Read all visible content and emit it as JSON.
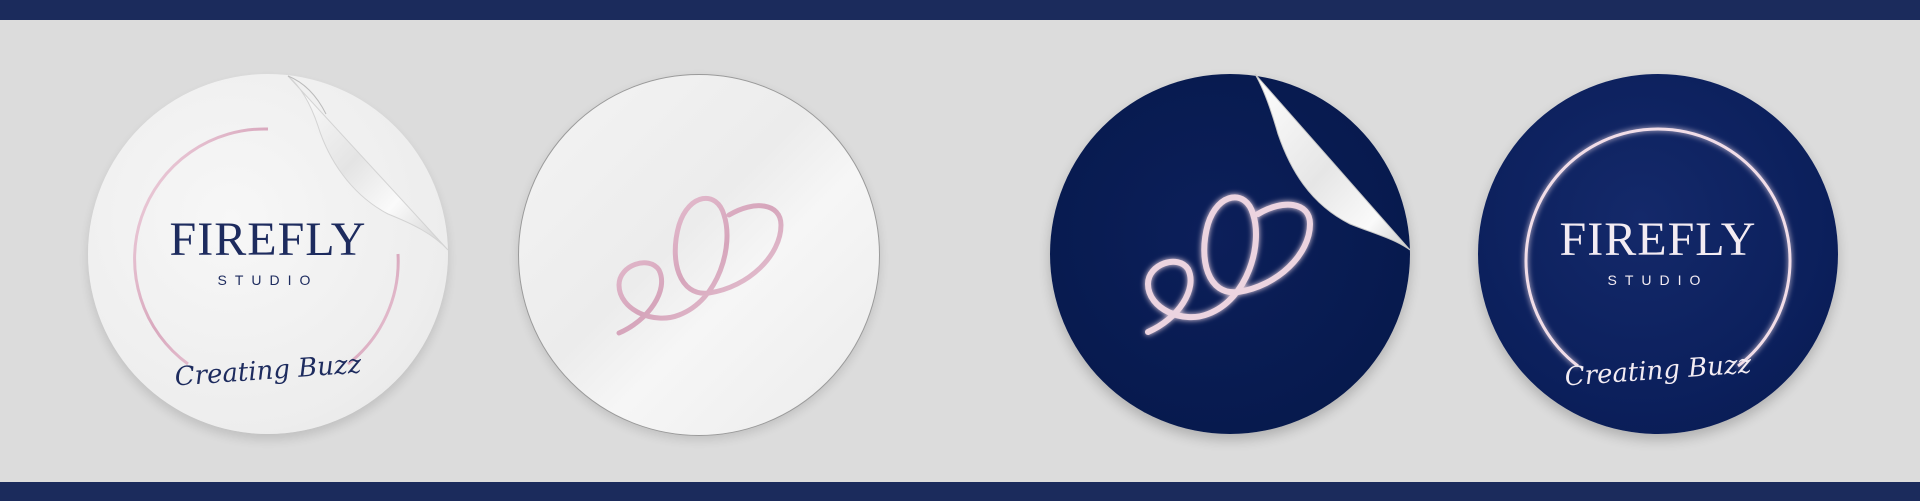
{
  "stickers": [
    {
      "brand": "FIREFLY",
      "subtitle": "STUDIO",
      "tagline": "Creating Buzz"
    },
    {
      "brand": "FIREFLY",
      "subtitle": "STUDIO",
      "tagline": "Creating Buzz"
    }
  ],
  "colors": {
    "navy": "#1b2b5c",
    "sticker_dark": "#071a4e",
    "pink_foil": "#e8c6d6",
    "background": "#dcdcdc"
  },
  "icons": [
    "peel-corner-icon",
    "firefly-scribble-icon",
    "arc-ring-icon"
  ]
}
